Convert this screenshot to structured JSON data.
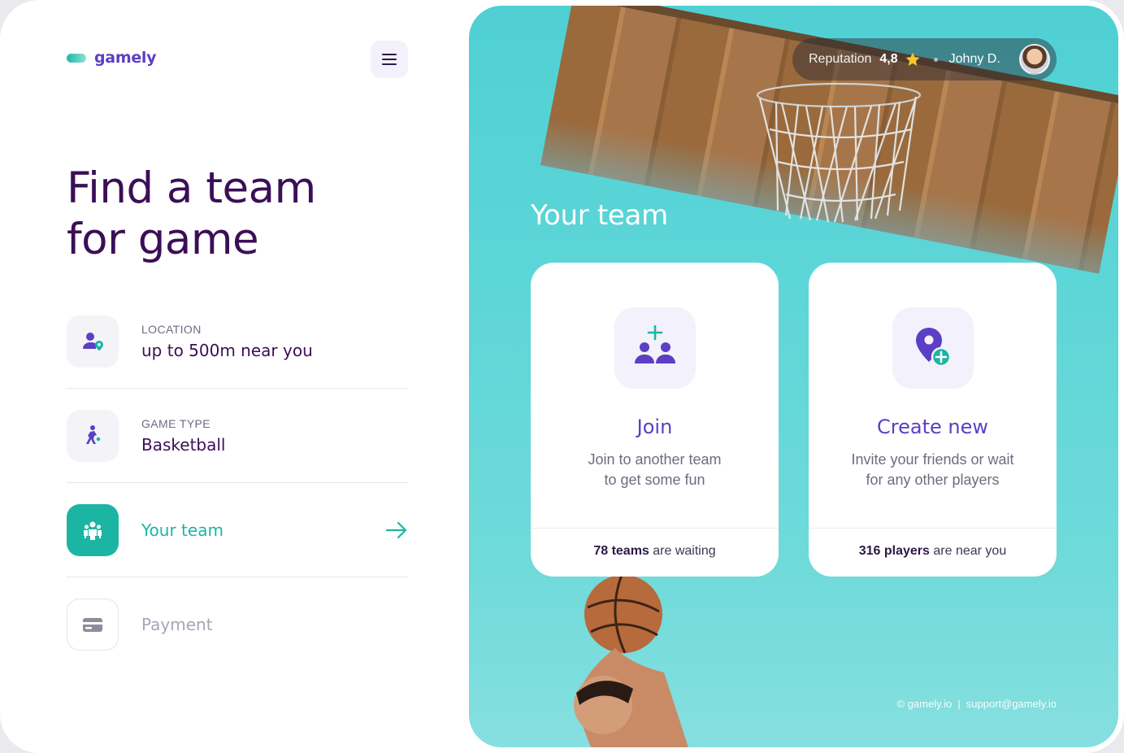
{
  "brand": {
    "name": "gamely"
  },
  "headline": {
    "line1": "Find a team",
    "line2": "for game"
  },
  "steps": [
    {
      "label": "LOCATION",
      "value": "up to 500m near you",
      "icon": "user-location-icon",
      "state": "done"
    },
    {
      "label": "GAME TYPE",
      "value": "Basketball",
      "icon": "basketball-player-icon",
      "state": "done"
    },
    {
      "label": "",
      "value": "Your team",
      "icon": "team-icon",
      "state": "active"
    },
    {
      "label": "",
      "value": "Payment",
      "icon": "credit-card-icon",
      "state": "disabled"
    }
  ],
  "topbar": {
    "reputation_label": "Reputation",
    "reputation_value": "4,8",
    "user_name": "Johny D."
  },
  "section_title": "Your team",
  "cards": [
    {
      "title": "Join",
      "desc_line1": "Join to another team",
      "desc_line2": "to get some fun",
      "foot_bold": "78 teams",
      "foot_rest": "are waiting",
      "icon": "add-group-icon"
    },
    {
      "title": "Create new",
      "desc_line1": "Invite your friends or wait",
      "desc_line2": "for any other players",
      "foot_bold": "316 players",
      "foot_rest": "are near you",
      "icon": "add-location-icon"
    }
  ],
  "footer": {
    "copyright": "© gamely.io",
    "separator": "|",
    "email": "support@gamely.io"
  },
  "colors": {
    "primary": "#5b3fc4",
    "accent": "#1cb5a4",
    "heading": "#3b0f57",
    "panel_bg": "#5ed6d8"
  }
}
